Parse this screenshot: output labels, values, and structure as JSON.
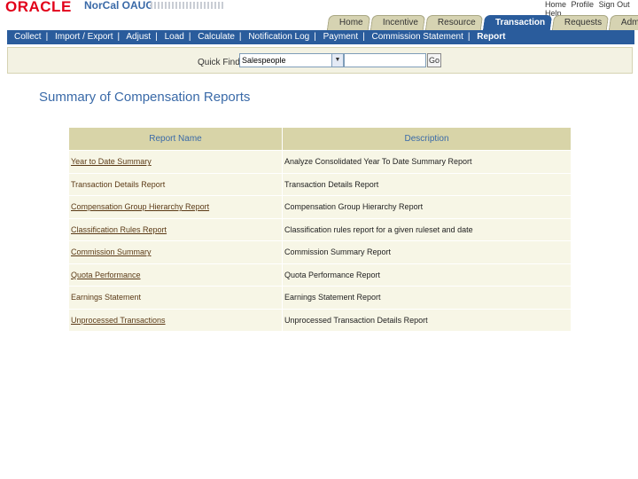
{
  "header": {
    "logo": "ORACLE",
    "org": "NorCal OAUG",
    "global_links": [
      "Home",
      "Profile",
      "Sign Out",
      "Help"
    ]
  },
  "tabs": [
    {
      "label": "Home",
      "active": false
    },
    {
      "label": "Incentive",
      "active": false
    },
    {
      "label": "Resource",
      "active": false
    },
    {
      "label": "Transaction",
      "active": true
    },
    {
      "label": "Requests",
      "active": false
    },
    {
      "label": "Administration",
      "active": false
    }
  ],
  "subnav": [
    {
      "label": "Collect",
      "current": false
    },
    {
      "label": "Import / Export",
      "current": false
    },
    {
      "label": "Adjust",
      "current": false
    },
    {
      "label": "Load",
      "current": false
    },
    {
      "label": "Calculate",
      "current": false
    },
    {
      "label": "Notification Log",
      "current": false
    },
    {
      "label": "Payment",
      "current": false
    },
    {
      "label": "Commission Statement",
      "current": false
    },
    {
      "label": "Report",
      "current": true
    }
  ],
  "quickfind": {
    "label": "Quick Find",
    "selected": "Salespeople",
    "value": "",
    "go_label": "Go"
  },
  "page": {
    "title": "Summary of Compensation Reports"
  },
  "table": {
    "headers": [
      "Report Name",
      "Description"
    ],
    "rows": [
      {
        "name": "Year to Date Summary",
        "description": "Analyze Consolidated Year To Date Summary Report",
        "link": true
      },
      {
        "name": "Transaction Details Report",
        "description": "Transaction Details Report",
        "link": false
      },
      {
        "name": "Compensation Group Hierarchy Report",
        "description": "Compensation Group Hierarchy Report",
        "link": true
      },
      {
        "name": "Classification Rules Report",
        "description": "Classification rules report for a given ruleset and date",
        "link": true
      },
      {
        "name": "Commission Summary",
        "description": "Commission Summary Report",
        "link": true
      },
      {
        "name": "Quota Performance",
        "description": "Quota Performance Report",
        "link": true
      },
      {
        "name": "Earnings Statement",
        "description": "Earnings Statement Report",
        "link": false
      },
      {
        "name": "Unprocessed Transactions",
        "description": "Unprocessed Transaction Details Report",
        "link": true
      }
    ]
  }
}
